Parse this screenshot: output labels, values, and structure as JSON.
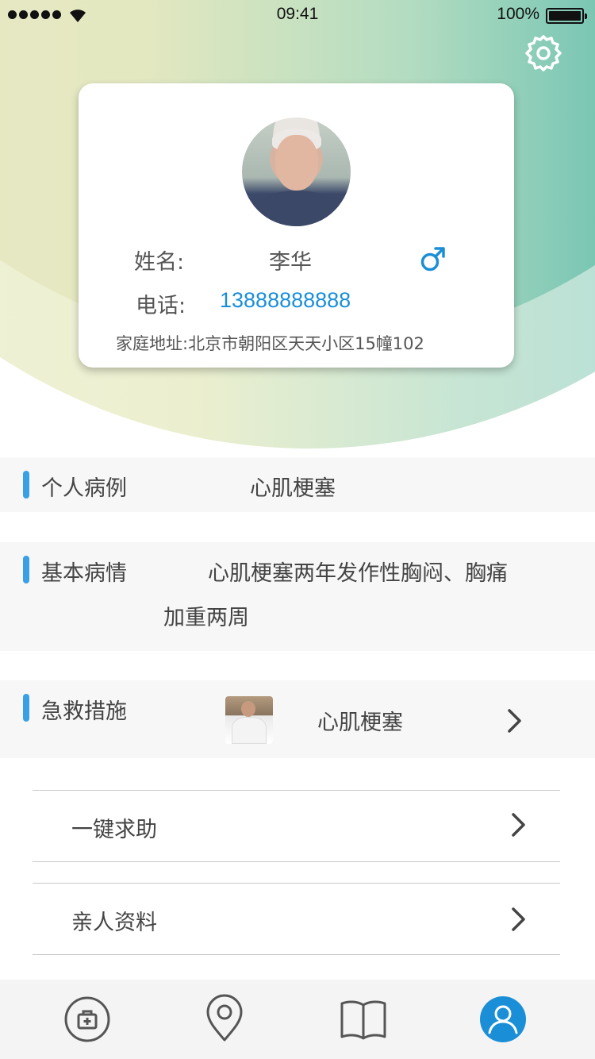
{
  "status_bar": {
    "time": "09:41",
    "battery": "100%",
    "signal_icon": "signal-dots-icon",
    "wifi_icon": "wifi-icon"
  },
  "header": {
    "settings_icon": "gear-icon"
  },
  "profile": {
    "name_label": "姓名:",
    "name": "李华",
    "gender_icon": "male-symbol-icon",
    "phone_label": "电话:",
    "phone": "13888888888",
    "address_label": "家庭地址:",
    "address": "北京市朝阳区天天小区15幢102"
  },
  "sections": {
    "case": {
      "title": "个人病例",
      "value": "心肌梗塞"
    },
    "condition": {
      "title": "基本病情",
      "line1": "心肌梗塞两年发作性胸闷、胸痛",
      "line2": "加重两周"
    },
    "first_aid": {
      "title": "急救措施",
      "value": "心肌梗塞"
    }
  },
  "list": [
    {
      "label": "一键求助"
    },
    {
      "label": "亲人资料"
    }
  ],
  "tabbar": {
    "items": [
      "medical-kit-icon",
      "location-pin-icon",
      "book-icon",
      "profile-icon"
    ],
    "active_index": 3
  },
  "colors": {
    "accent": "#1a8fd8",
    "section_bar": "#3aa0e6",
    "teal": "#3fada0"
  }
}
